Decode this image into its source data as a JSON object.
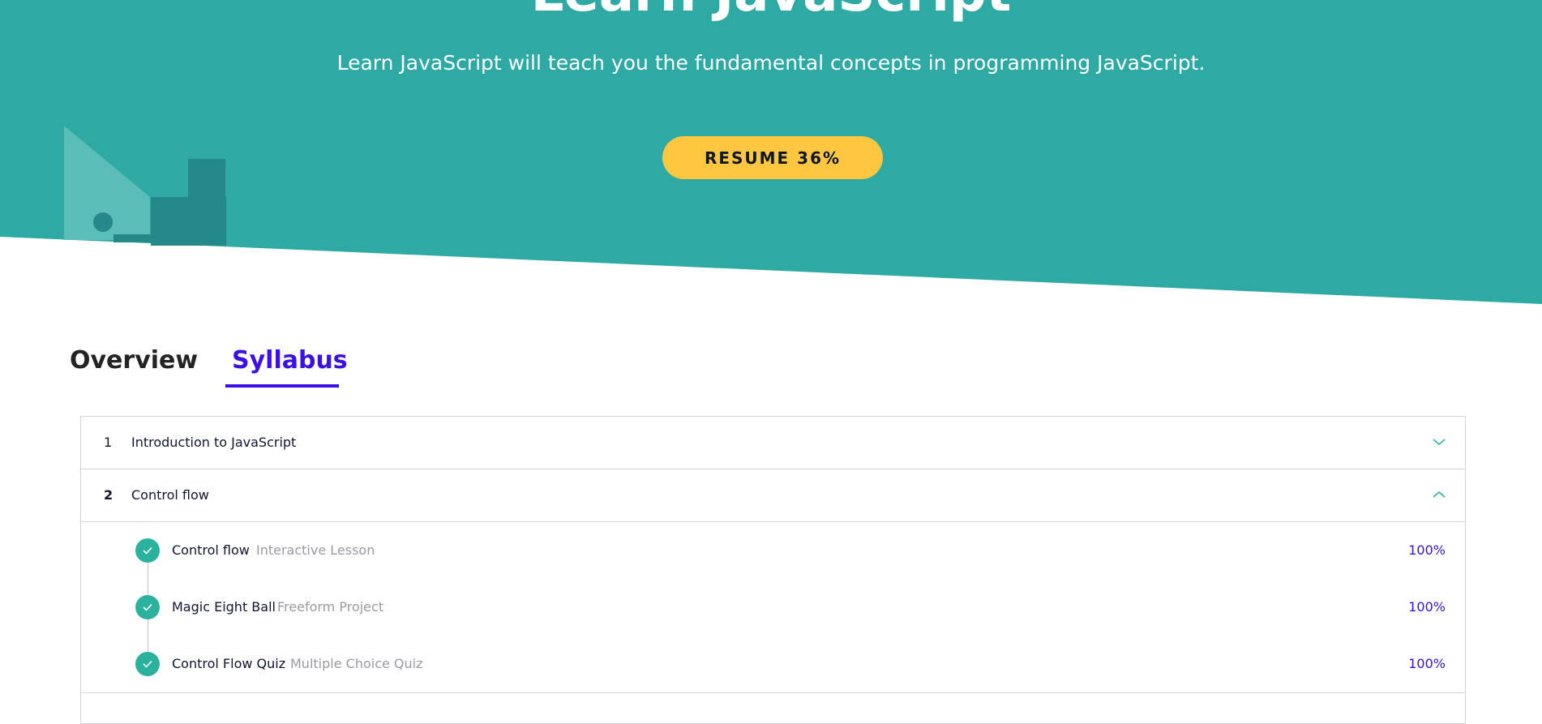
{
  "colors": {
    "hero_bg": "#2ea9a4",
    "resume_button": "#ffc740",
    "accent": "#3a10e5",
    "check": "#2ab29f"
  },
  "hero": {
    "title": "Learn JavaScript",
    "subtitle": "Learn JavaScript will teach you the fundamental concepts in programming JavaScript.",
    "resume_label": "RESUME 36%",
    "progress_percent": 36
  },
  "tabs": [
    {
      "label": "Overview",
      "active": false
    },
    {
      "label": "Syllabus",
      "active": true
    }
  ],
  "syllabus": {
    "modules": [
      {
        "number": "1",
        "title": "Introduction to JavaScript",
        "expanded": false,
        "icon": "chevron-down-icon"
      },
      {
        "number": "2",
        "title": "Control flow",
        "expanded": true,
        "icon": "chevron-up-icon"
      }
    ],
    "items": [
      {
        "title": "Control flow",
        "type": "Interactive Lesson",
        "percent": "100%",
        "icon": "check-icon"
      },
      {
        "title": "Magic Eight Ball",
        "type": "Freeform Project",
        "percent": "100%",
        "icon": "check-icon"
      },
      {
        "title": "Control Flow Quiz",
        "type": "Multiple Choice Quiz",
        "percent": "100%",
        "icon": "check-icon"
      }
    ]
  }
}
